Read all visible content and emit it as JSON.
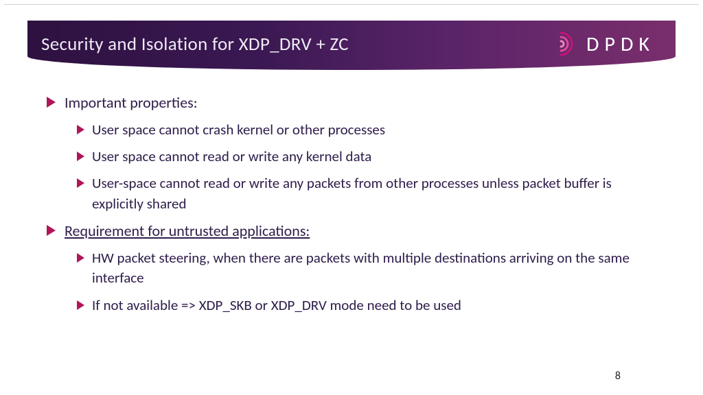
{
  "header": {
    "title": "Security and Isolation for XDP_DRV + ZC",
    "logo_text": "DPDK"
  },
  "content": {
    "section1": {
      "heading": "Important properties:",
      "items": [
        "User space cannot crash kernel or other processes",
        "User space cannot read or write any kernel data",
        "User-space cannot read or write any packets from other processes unless packet buffer is explicitly shared"
      ]
    },
    "section2": {
      "heading": "Requirement for untrusted applications:",
      "items": [
        "HW packet steering, when there are packets with multiple destinations arriving on the same interface",
        "If not available => XDP_SKB or XDP_DRV mode need to be used"
      ]
    }
  },
  "page_number": "8"
}
